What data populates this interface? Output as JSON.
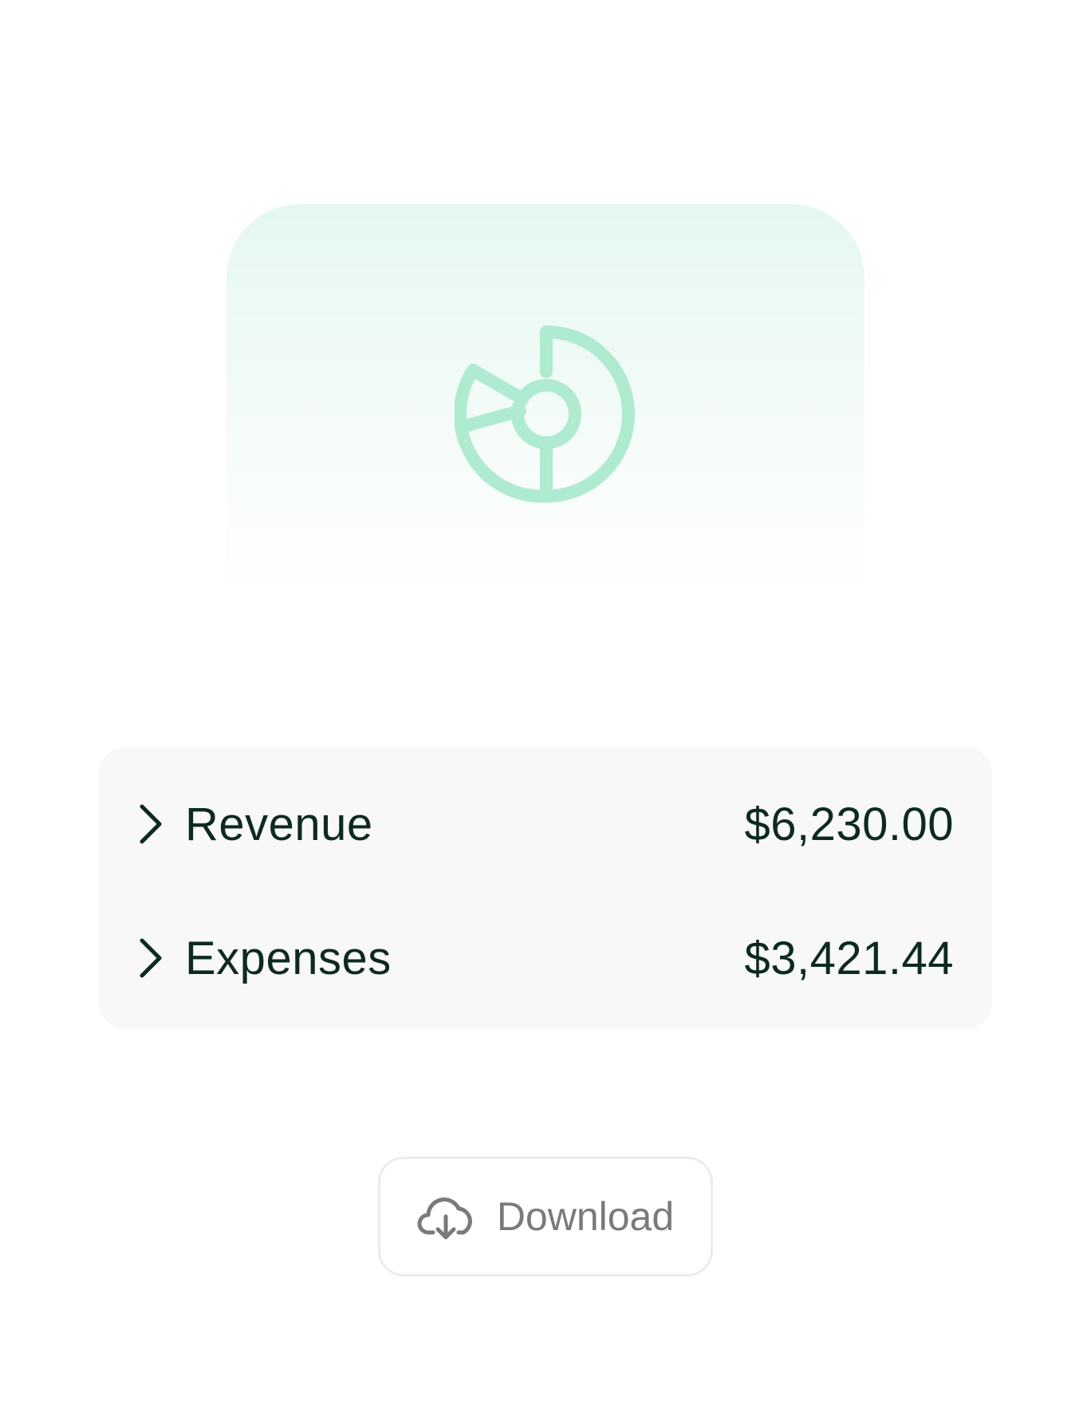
{
  "hero": {
    "icon": "donut-chart-icon",
    "accent_color": "#aeebd1"
  },
  "summary": {
    "rows": [
      {
        "label": "Revenue",
        "value": "$6,230.00",
        "icon": "chevron-right-icon"
      },
      {
        "label": "Expenses",
        "value": "$3,421.44",
        "icon": "chevron-right-icon"
      }
    ]
  },
  "download": {
    "label": "Download",
    "icon": "cloud-download-icon"
  },
  "colors": {
    "text_primary": "#0d2a1f",
    "text_muted": "#7a7a7a",
    "panel_bg": "#f8f8f8"
  }
}
